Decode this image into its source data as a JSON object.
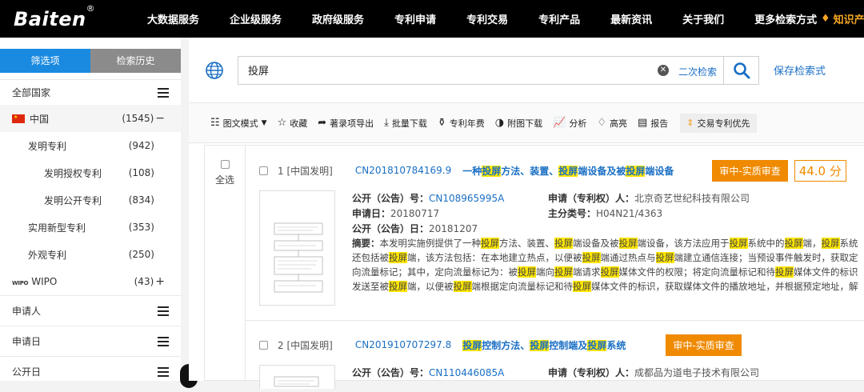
{
  "brand": {
    "name": "Baiten",
    "mark": "®"
  },
  "nav": [
    "大数据服务",
    "企业级服务",
    "政府级服务",
    "专利申请",
    "专利交易",
    "专利产品",
    "最新资讯",
    "关于我们",
    "更多检索方式"
  ],
  "nav_extra": "知识产",
  "sidebar": {
    "tabs": [
      "筛选项",
      "检索历史"
    ],
    "section_all_countries": "全部国家",
    "filters": [
      {
        "label": "中国",
        "count": "(1545)",
        "sign": "−"
      },
      {
        "label": "发明专利",
        "count": "(942)"
      },
      {
        "label": "发明授权专利",
        "count": "(108)"
      },
      {
        "label": "发明公开专利",
        "count": "(834)"
      },
      {
        "label": "实用新型专利",
        "count": "(353)"
      },
      {
        "label": "外观专利",
        "count": "(250)"
      },
      {
        "label": "WIPO",
        "count": "(43)",
        "sign": "+",
        "mark": "WIPO"
      }
    ],
    "sections": [
      "申请人",
      "申请日",
      "公开日"
    ]
  },
  "search": {
    "value": "投屏",
    "secondary": "二次检索",
    "save": "保存检索式"
  },
  "toolbar": [
    "图文模式",
    "收藏",
    "著录项导出",
    "批量下载",
    "专利年费",
    "附图下载",
    "分析",
    "高亮",
    "报告",
    "交易专利优先"
  ],
  "select_all": "全选",
  "results": [
    {
      "num": "1 [中国发明]",
      "id": "CN201810784169.9",
      "title_parts": [
        "一种",
        "投屏",
        "方法、装置、",
        "投屏",
        "端设备及被",
        "投屏",
        "端设备"
      ],
      "status": "审中-实质审查",
      "score": "44.0 分",
      "pub_label": "公开（公告）号：",
      "pub_no": "CN108965995A",
      "app_label": "申请（专利权）人：",
      "applicant": "北京奇艺世纪科技有限公司",
      "appdate_label": "申请日：",
      "appdate": "20180717",
      "ipc_label": "主分类号：",
      "ipc": "H04N21/4363",
      "pubdate_label": "公开（公告）日：",
      "pubdate": "20181207",
      "abstract_label": "摘要：",
      "abstract": "本发明实施例提供了一种投屏方法、装置、投屏端设备及被投屏端设备，该方法应用于投屏系统中的投屏端，投屏系统还包括被投屏端，该方法包括：在本地建立热点，以便被投屏端通过热点与投屏端建立通信连接；当预设事件触发时，获取定向流量标记；其中，定向流量标记为：被投屏端向投屏端请求投屏媒体文件的权限；将定向流量标记和待投屏媒体文件的标识发送至被投屏端，以便被投屏端根据定向流量标记和待投屏媒体文件的标识，获取媒体文件的播放地址，并根据预定地址，解析并播放待投屏媒体文件。本发明实施例可以实现投屏端和被投屏端之间的免流量投屏。"
    },
    {
      "num": "2 [中国发明]",
      "id": "CN201910707297.8",
      "title_parts": [
        "",
        "投屏",
        "控制方法、",
        "投屏",
        "控制端及",
        "投屏",
        "系统"
      ],
      "status": "审中-实质审查",
      "pub_label": "公开（公告）号：",
      "pub_no": "CN110446085A",
      "app_label": "申请（专利权）人：",
      "applicant": "成都品为道电子技术有限公司"
    }
  ],
  "colors": {
    "topbar": "#000000",
    "accent_blue": "#1a8ae0",
    "link": "#1a6fc4",
    "badge": "#f08a00",
    "highlight": "#ffe600"
  }
}
